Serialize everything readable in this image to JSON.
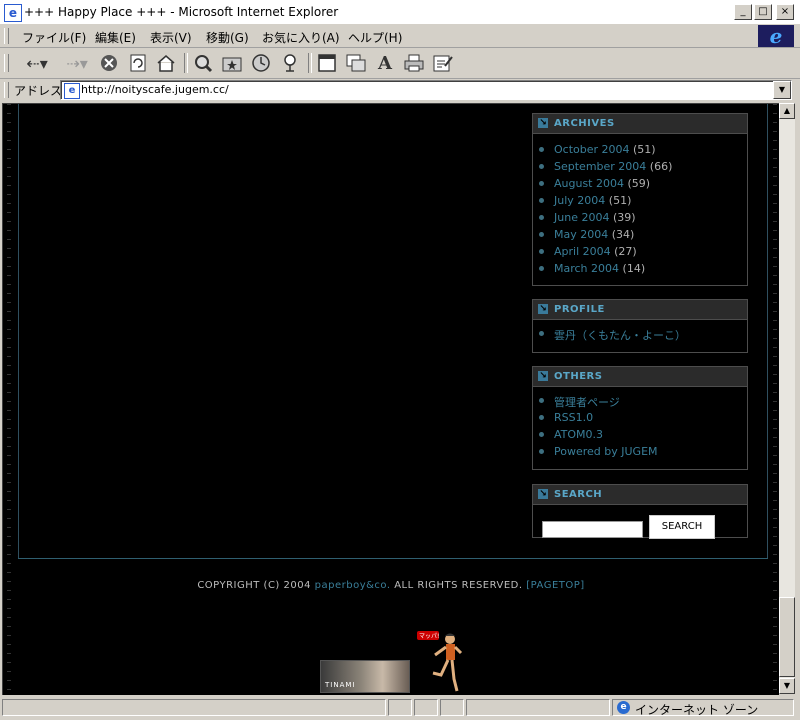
{
  "window": {
    "title": "+++ Happy Place +++ - Microsoft Internet Explorer",
    "controls": [
      "_",
      "□",
      "×"
    ]
  },
  "menubar": {
    "items": [
      "ファイル(F)",
      "編集(E)",
      "表示(V)",
      "移動(G)",
      "お気に入り(A)",
      "ヘルプ(H)"
    ]
  },
  "toolbar": {
    "icons": [
      "back-icon",
      "forward-icon",
      "stop-icon",
      "refresh-icon",
      "home-icon",
      "search-icon",
      "favorites-icon",
      "history-icon",
      "channels-icon",
      "fullscreen-icon",
      "mail-icon",
      "font-icon",
      "print-icon",
      "edit-icon"
    ]
  },
  "address": {
    "label": "アドレス",
    "url": "http://noityscafe.jugem.cc/"
  },
  "sidebar": {
    "archives": {
      "title": "ARCHIVES",
      "items": [
        {
          "label": "October 2004",
          "count": "(51)"
        },
        {
          "label": "September 2004",
          "count": "(66)"
        },
        {
          "label": "August 2004",
          "count": "(59)"
        },
        {
          "label": "July 2004",
          "count": "(51)"
        },
        {
          "label": "June 2004",
          "count": "(39)"
        },
        {
          "label": "May 2004",
          "count": "(34)"
        },
        {
          "label": "April 2004",
          "count": "(27)"
        },
        {
          "label": "March 2004",
          "count": "(14)"
        }
      ]
    },
    "profile": {
      "title": "PROFILE",
      "items": [
        {
          "label": "雲丹（くもたん・よーこ）"
        }
      ]
    },
    "others": {
      "title": "OTHERS",
      "items": [
        {
          "label": "管理者ページ"
        },
        {
          "label": "RSS1.0"
        },
        {
          "label": "ATOM0.3"
        },
        {
          "label": "Powered by JUGEM"
        }
      ]
    },
    "search": {
      "title": "SEARCH",
      "input_value": "",
      "button_label": "SEARCH"
    }
  },
  "footer": {
    "copyright_prefix": "COPYRIGHT (C) 2004",
    "company": "paperboy&co.",
    "rights": "ALL RIGHTS RESERVED.",
    "pagetop": "[PAGETOP]",
    "banner_text": "TINAMI"
  },
  "mascot": {
    "bubble_text": "マッパ!"
  },
  "statusbar": {
    "zone": "インターネット ゾーン"
  }
}
